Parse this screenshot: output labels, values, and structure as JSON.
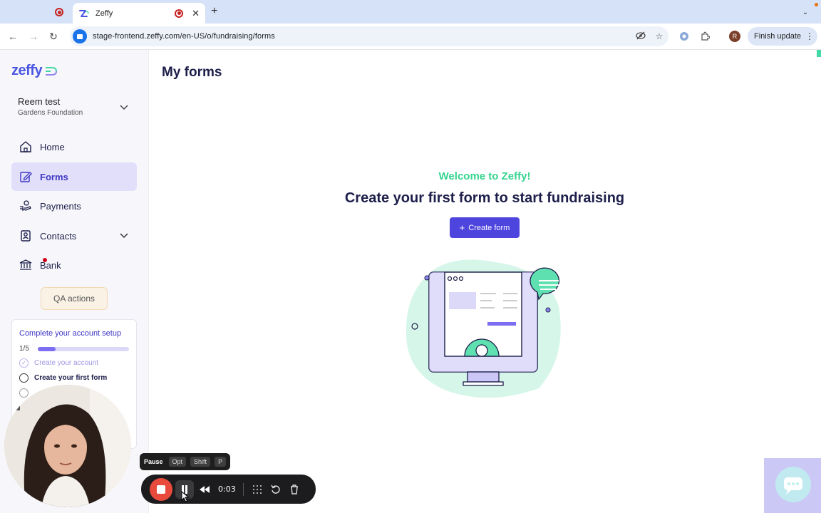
{
  "browser": {
    "tab_title": "Zeffy",
    "url": "stage-frontend.zeffy.com/en-US/o/fundraising/forms",
    "profile_initial": "R",
    "finish_update": "Finish update"
  },
  "sidebar": {
    "logo": "zeffy",
    "org_name": "Reem test",
    "org_subtitle": "Gardens Foundation",
    "items": [
      {
        "label": "Home"
      },
      {
        "label": "Forms"
      },
      {
        "label": "Payments"
      },
      {
        "label": "Contacts"
      },
      {
        "label": "Bank"
      }
    ],
    "qa_actions": "QA actions",
    "setup": {
      "title": "Complete your account setup",
      "progress_text": "1/5",
      "progress": 0.2,
      "steps": [
        {
          "label": "Create your account",
          "done": true
        },
        {
          "label": "Create your first form",
          "done": false
        }
      ]
    }
  },
  "main": {
    "page_title": "My forms",
    "welcome": "Welcome to Zeffy!",
    "headline": "Create your first form to start fundraising",
    "create_button": "Create form"
  },
  "recorder": {
    "tooltip_label": "Pause",
    "keys": [
      "Opt",
      "Shift",
      "P"
    ],
    "time": "0:03"
  },
  "colors": {
    "accent": "#4e45de",
    "welcome_green": "#35d48f",
    "nav_active_bg": "#e1dffa",
    "record_red": "#e84a3c"
  }
}
